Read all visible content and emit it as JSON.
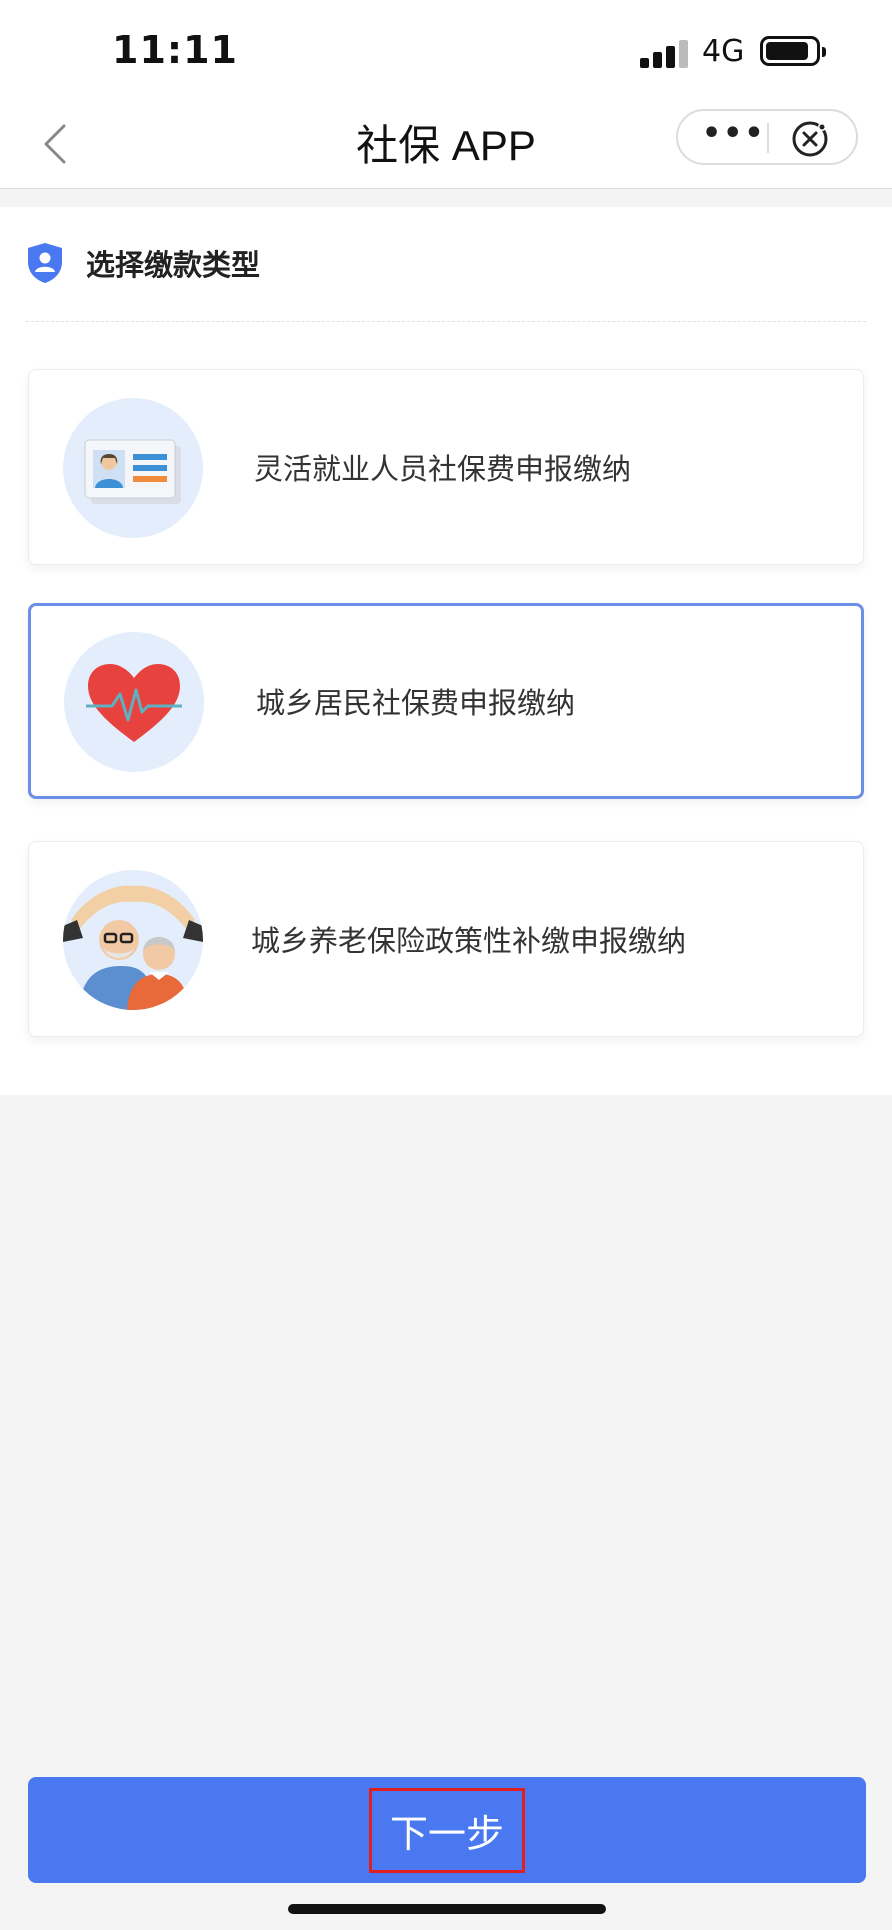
{
  "status_bar": {
    "time": "11:11",
    "network": "4G",
    "icons": [
      "signal-icon",
      "battery-icon"
    ]
  },
  "nav": {
    "title": "社保 APP",
    "icons": [
      "back-icon",
      "more-icon",
      "close-circle-icon"
    ]
  },
  "section": {
    "title": "选择缴款类型",
    "icon": "shield-user-icon",
    "accent": "#4a78f0"
  },
  "options": [
    {
      "label": "灵活就业人员社保费申报缴纳",
      "icon": "id-card-icon",
      "selected": false
    },
    {
      "label": "城乡居民社保费申报缴纳",
      "icon": "heart-pulse-icon",
      "selected": true
    },
    {
      "label": "城乡养老保险政策性补缴申报缴纳",
      "icon": "elderly-couple-icon",
      "selected": false
    }
  ],
  "footer": {
    "next_label": "下一步",
    "button_color": "#4a78f0",
    "highlight_color": "#e02020"
  }
}
